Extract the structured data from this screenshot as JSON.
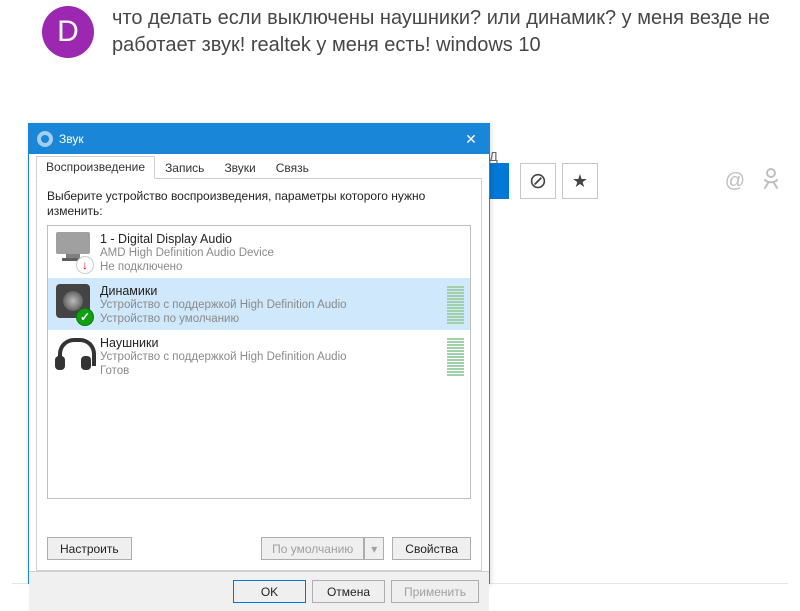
{
  "post": {
    "avatar_initial": "D",
    "text": "что делать если выключены наушники? или динамик? у меня везде не работает звук! realtek у меня есть! windows 10"
  },
  "toolbar_frag": {
    "letter": "Д",
    "at": "@",
    "ok": "⚲"
  },
  "dialog": {
    "title": "Звук",
    "tabs": [
      "Воспроизведение",
      "Запись",
      "Звуки",
      "Связь"
    ],
    "instruction": "Выберите устройство воспроизведения, параметры которого нужно изменить:",
    "devices": [
      {
        "name": "1 - Digital Display Audio",
        "line1": "AMD High Definition Audio Device",
        "line2": "Не подключено"
      },
      {
        "name": "Динамики",
        "line1": "Устройство с поддержкой High Definition Audio",
        "line2": "Устройство по умолчанию"
      },
      {
        "name": "Наушники",
        "line1": "Устройство с поддержкой High Definition Audio",
        "line2": "Готов"
      }
    ],
    "configure": "Настроить",
    "set_default": "По умолчанию",
    "properties": "Свойства",
    "ok": "OK",
    "cancel": "Отмена",
    "apply": "Применить"
  }
}
